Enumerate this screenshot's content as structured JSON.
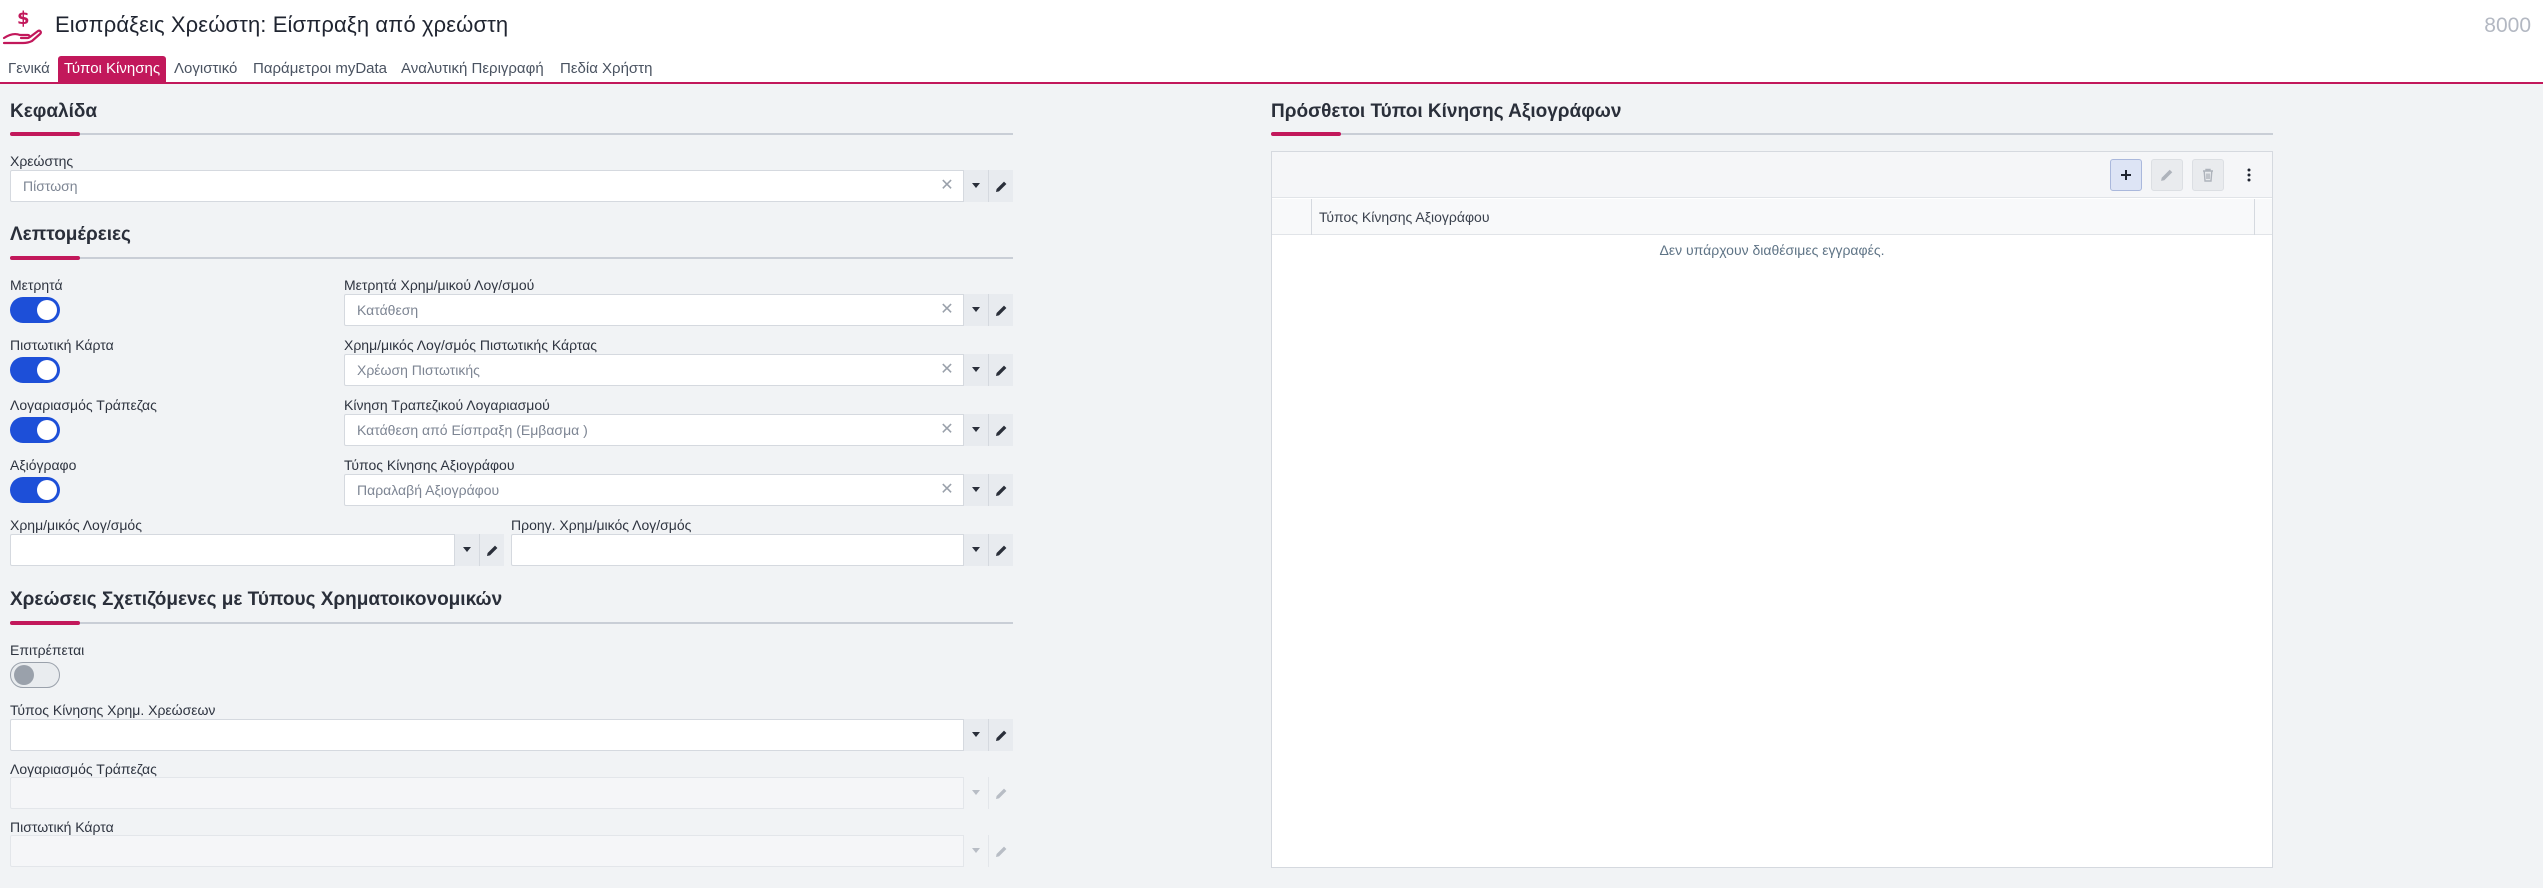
{
  "header": {
    "title": "Εισπράξεις Χρεώστη: Είσπραξη από χρεώστη",
    "code": "8000",
    "icon": "hand-coin-icon",
    "icon_color": "#c2185b"
  },
  "tabs": [
    {
      "label": "Γενικά",
      "active": false
    },
    {
      "label": "Τύποι Κίνησης",
      "active": true
    },
    {
      "label": "Λογιστικό",
      "active": false
    },
    {
      "label": "Παράμετροι myData",
      "active": false
    },
    {
      "label": "Αναλυτική Περιγραφή",
      "active": false
    },
    {
      "label": "Πεδία Χρήστη",
      "active": false
    }
  ],
  "sections": {
    "header_section": {
      "title": "Κεφαλίδα",
      "debtor_label": "Χρεώστης",
      "debtor_value": "Πίστωση"
    },
    "details": {
      "title": "Λεπτομέρειες",
      "cash_label": "Μετρητά",
      "cash_on": true,
      "cash_account_label": "Μετρητά Χρημ/μικού Λογ/σμού",
      "cash_account_value": "Κατάθεση",
      "credit_card_label": "Πιστωτική Κάρτα",
      "credit_card_on": true,
      "credit_card_account_label": "Χρημ/μικός Λογ/σμός Πιστωτικής Κάρτας",
      "credit_card_account_value": "Χρέωση Πιστωτικής",
      "bank_account_label": "Λογαριασμός Τράπεζας",
      "bank_account_on": true,
      "bank_movement_label": "Κίνηση Τραπεζικού Λογαριασμού",
      "bank_movement_value": "Κατάθεση από Είσπραξη (Εμβασμα )",
      "cheque_label": "Αξιόγραφο",
      "cheque_on": true,
      "cheque_movement_label": "Τύπος Κίνησης Αξιογράφου",
      "cheque_movement_value": "Παραλαβή Αξιογράφου",
      "fin_account_label": "Χρημ/μικός Λογ/σμός",
      "fin_account_value": "",
      "prev_fin_account_label": "Προηγ. Χρημ/μικός Λογ/σμός",
      "prev_fin_account_value": ""
    },
    "charges": {
      "title": "Χρεώσεις Σχετιζόμενες με Τύπους Χρηματοικονομικών",
      "allowed_label": "Επιτρέπεται",
      "allowed_on": false,
      "charge_type_label": "Τύπος Κίνησης Χρημ. Χρεώσεων",
      "charge_type_value": "",
      "bank_account_label": "Λογαριασμός Τράπεζας",
      "bank_account_value": "",
      "credit_card_label": "Πιστωτική Κάρτα",
      "credit_card_value": ""
    }
  },
  "right_panel": {
    "title": "Πρόσθετοι Τύποι Κίνησης Αξιογράφων",
    "column": "Τύπος Κίνησης Αξιογράφου",
    "empty_text": "Δεν υπάρχουν διαθέσιμες εγγραφές.",
    "toolbar": {
      "add": "plus-icon",
      "edit": "pencil-icon",
      "delete": "trash-icon",
      "more": "kebab-menu-icon"
    }
  },
  "colors": {
    "accent": "#c2185b",
    "toggle_on": "#1d4fd8",
    "background": "#f1f3f5"
  }
}
